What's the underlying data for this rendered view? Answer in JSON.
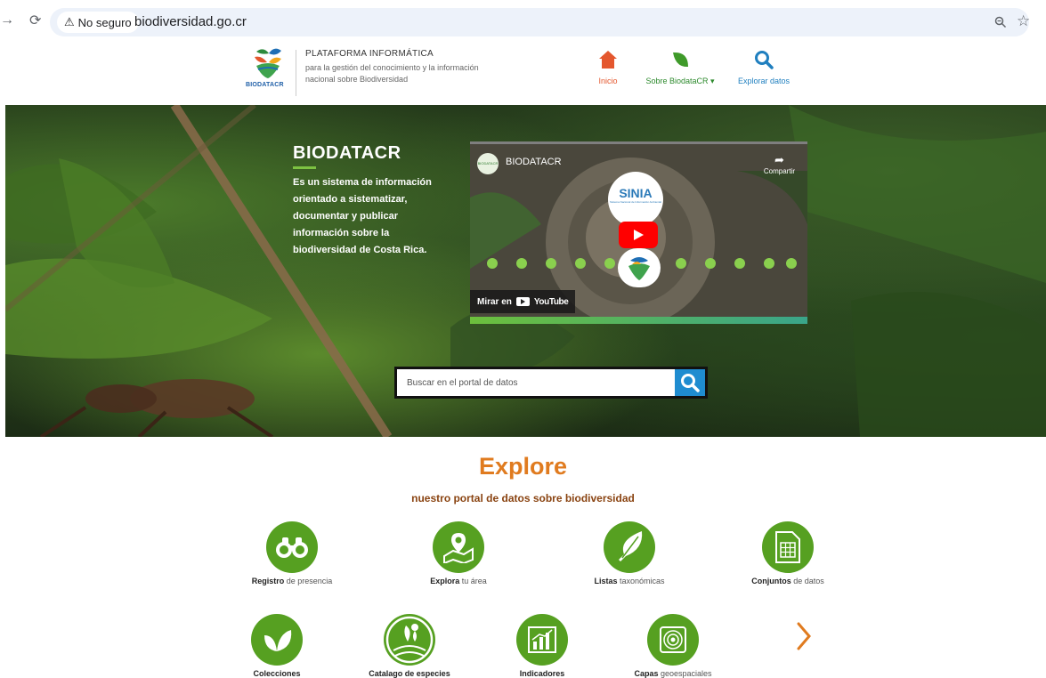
{
  "browser": {
    "security_label": "No seguro",
    "url": "biodiversidad.go.cr"
  },
  "header": {
    "logo_text": "BIODATACR",
    "platform_title": "PLATAFORMA INFORMÁTICA",
    "platform_line2": "para la gestión del conocimiento y la información",
    "platform_line3": "nacional sobre Biodiversidad",
    "nav": {
      "inicio": "Inicio",
      "sobre": "Sobre BiodataCR ▾",
      "explorar": "Explorar datos"
    }
  },
  "hero": {
    "title": "BIODATACR",
    "description": "Es un sistema de información orientado a sistematizar, documentar y publicar información sobre la biodiversidad de Costa Rica.",
    "video": {
      "channel_name": "BIODATACR",
      "share_label": "Compartir",
      "sinia_label": "SINIA",
      "sinia_sub": "Sistema Nacional de Información Ambiental",
      "watch_label": "Mirar en",
      "youtube_word": "YouTube"
    },
    "search_placeholder": "Buscar en el portal de datos"
  },
  "explore": {
    "title": "Explore",
    "subtitle": "nuestro portal de datos sobre biodiversidad",
    "row1": [
      {
        "bold": "Registro",
        "rest": " de presencia"
      },
      {
        "bold": "Explora",
        "rest": " tu área"
      },
      {
        "bold": "Listas",
        "rest": " taxonómicas"
      },
      {
        "bold": "Conjuntos",
        "rest": " de datos"
      }
    ],
    "row2": [
      {
        "bold": "Colecciones",
        "rest": ""
      },
      {
        "bold": "Catalago de especies",
        "rest": ""
      },
      {
        "bold": "Indicadores",
        "rest": ""
      },
      {
        "bold": "Capas",
        "rest": " geoespaciales"
      }
    ]
  },
  "colors": {
    "accent_orange": "#e07b1f",
    "tile_green": "#56a021",
    "search_blue": "#1f8cd0"
  }
}
